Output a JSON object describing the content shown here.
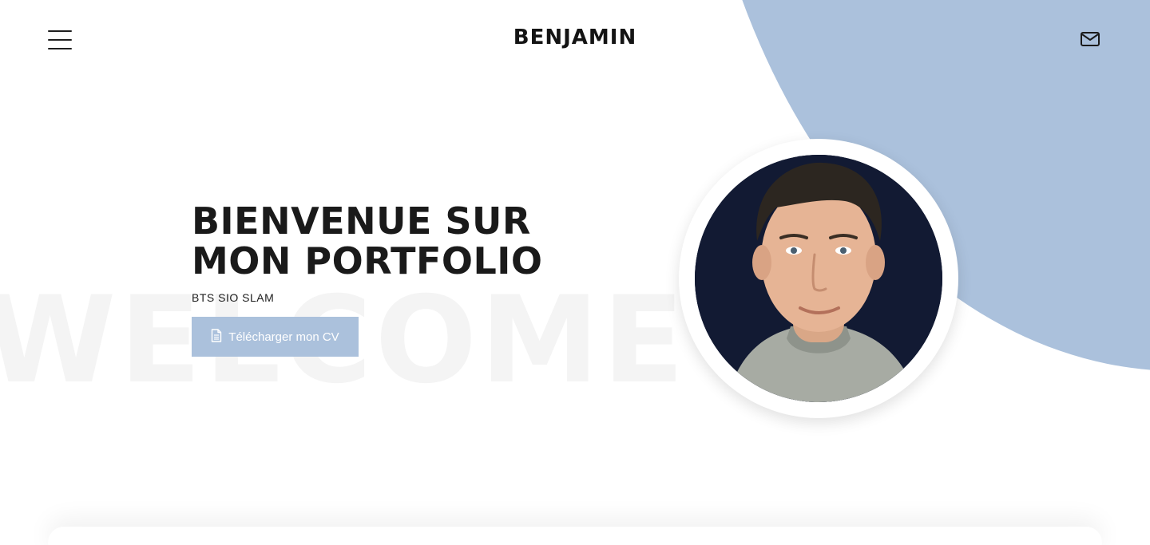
{
  "header": {
    "brand": "BENJAMIN",
    "menu_icon": "hamburger-menu-icon",
    "mail_icon": "envelope-icon"
  },
  "hero": {
    "watermark": "WELCOME",
    "title_line1": "BIENVENUE SUR",
    "title_line2": "MON PORTFOLIO",
    "subtitle": "BTS SIO SLAM",
    "cv_button_label": "Télécharger mon CV",
    "cv_button_icon": "document-icon"
  },
  "colors": {
    "accent": "#abc1dc",
    "text": "#1a1a1a",
    "watermark": "#f4f4f4",
    "photo_background": "#121a33"
  }
}
